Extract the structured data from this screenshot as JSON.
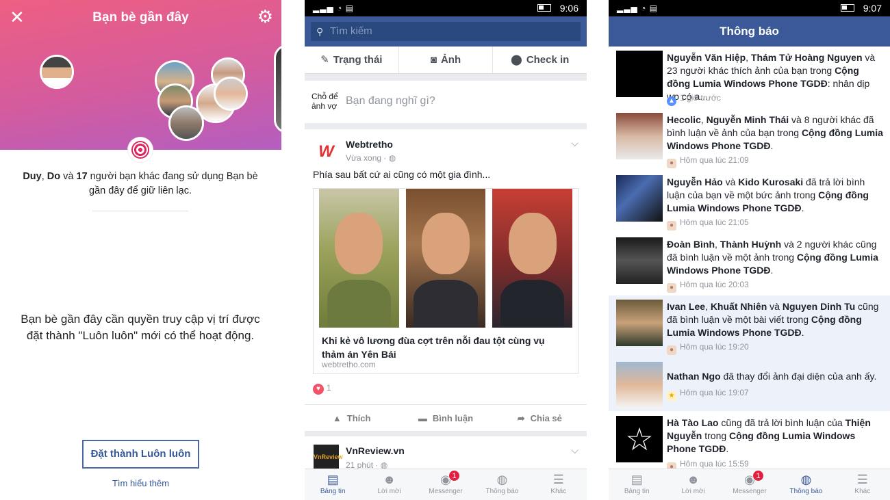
{
  "nearby": {
    "title": "Bạn bè gần đây",
    "info_name1": "Duy",
    "info_sep1": ", ",
    "info_name2": "Do",
    "info_sep2": " và ",
    "info_count": "17",
    "info_text": " người bạn khác đang sử dụng Bạn bè gần đây để giữ liên lạc.",
    "permission_text": "Bạn bè gần đây cần quyền truy cập vị trí được đặt thành \"Luôn luôn\" mới có thể hoạt động.",
    "set_always_button": "Đặt thành Luôn luôn",
    "learn_more": "Tìm hiểu thêm"
  },
  "news_feed": {
    "status_bar_time": "9:06",
    "search_placeholder": "Tìm kiếm",
    "composer": {
      "status": "Trạng thái",
      "photo": "Ảnh",
      "checkin": "Check in",
      "user_label": "Chỗ để ảnh vợ",
      "prompt": "Bạn đang nghĩ gì?"
    },
    "post": {
      "page_name": "Webtretho",
      "time": "Vừa xong · ",
      "text": "Phía sau bất cứ ai cũng có một gia đình...",
      "link_title": "Khi kẻ vô lương đùa cợt trên nỗi đau tột cùng vụ thảm án Yên Bái",
      "link_domain": "webtretho.com",
      "reaction_count": "1",
      "like": "Thích",
      "comment": "Bình luận",
      "share": "Chia sẻ"
    },
    "post2": {
      "page_name": "VnReview.vn",
      "time": "21 phút · ",
      "logo_text": "VnReview"
    }
  },
  "tabs": [
    {
      "label": "Bảng tin",
      "icon": "newsfeed-icon"
    },
    {
      "label": "Lời mời",
      "icon": "friend-requests-icon"
    },
    {
      "label": "Messenger",
      "icon": "messenger-icon",
      "badge": "1"
    },
    {
      "label": "Thông báo",
      "icon": "globe-icon"
    },
    {
      "label": "Khác",
      "icon": "menu-icon"
    }
  ],
  "notifications": {
    "status_bar_time": "9:07",
    "title": "Thông báo",
    "items": [
      {
        "a": "Nguyễn Văn Hiệp",
        "b": ", ",
        "c": "Thám Tử Hoàng Nguyen",
        "d": " và 23 người khác thích ảnh của bạn trong ",
        "e": "Cộng đồng Lumia Windows Phone TGDĐ",
        "f": ": nhân dịp wp có a...",
        "time": "1 giờ trước",
        "icon": "like"
      },
      {
        "a": "Hecolic",
        "b": ", ",
        "c": "Nguyễn Minh Thái",
        "d": " và 8 người khác đã bình luận về ảnh của bạn trong ",
        "e": "Cộng đồng Lumia Windows Phone TGDĐ",
        "f": ".",
        "time": "Hôm qua lúc 21:09",
        "icon": "comment"
      },
      {
        "a": "Nguyễn Hảo",
        "b": " và ",
        "c": "Kido Kurosaki",
        "d": " đã trả lời bình luận của bạn về một bức ảnh trong ",
        "e": "Cộng đồng Lumia Windows Phone TGDĐ",
        "f": ".",
        "time": "Hôm qua lúc 21:05",
        "icon": "comment"
      },
      {
        "a": "Đoàn Bình",
        "b": ", ",
        "c": "Thành Huỳnh",
        "d": " và 2 người khác cũng đã bình luận về một ảnh trong ",
        "e": "Cộng đồng Lumia Windows Phone TGDĐ",
        "f": ".",
        "time": "Hôm qua lúc 20:03",
        "icon": "comment"
      },
      {
        "a": "Ivan Lee",
        "b": ", ",
        "c": "Khuất Nhiên",
        "d": " và ",
        "e": "Nguyen Dinh Tu",
        "f": " cũng đã bình luận về một bài viết trong ",
        "g": "Cộng đồng Lumia Windows Phone TGDĐ",
        "h": ".",
        "time": "Hôm qua lúc 19:20",
        "icon": "comment"
      },
      {
        "a": "Nathan Ngo",
        "d": " đã thay đổi ảnh đại diện của anh ấy.",
        "time": "Hôm qua lúc 19:07",
        "icon": "star"
      },
      {
        "a": "Hà Tào Lao",
        "d": " cũng đã trả lời bình luận của ",
        "c": "Thiện Nguyễn",
        "f": " trong ",
        "e": "Cộng đồng Lumia Windows Phone TGDĐ",
        "h": ".",
        "time": "Hôm qua lúc 15:59",
        "icon": "comment"
      }
    ]
  }
}
